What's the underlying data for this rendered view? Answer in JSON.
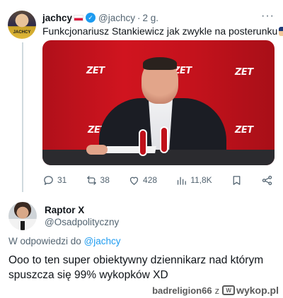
{
  "tweet1": {
    "name": "jachcy",
    "handle": "@jachcy",
    "separator": "·",
    "time": "2 g.",
    "text": "Funkcjonariusz Stankiewicz jak zwykle na posterunku",
    "avatar_text": "JACHCY",
    "more_label": "···",
    "media_logo": "ZET",
    "actions": {
      "replies": "31",
      "retweets": "38",
      "likes": "428",
      "views": "11,8K"
    }
  },
  "tweet2": {
    "name": "Raptor X",
    "handle": "@Osadpolityczny",
    "reply_prefix": "W odpowiedzi do",
    "reply_handle": "@jachcy",
    "text": "Ooo to ten super obiektywny dziennikarz nad którym spuszcza się 99% wykopków XD"
  },
  "footer": {
    "user": "badreligion66",
    "z": "z",
    "site": "wykop.pl",
    "site_mark": "W"
  },
  "colors": {
    "accent": "#1d9bf0",
    "muted": "#536471",
    "media_red": "#c4121c"
  },
  "icons": [
    "verified-icon",
    "poland-flag-icon",
    "police-emoji-icon",
    "reply-icon",
    "retweet-icon",
    "like-icon",
    "views-icon",
    "bookmark-icon",
    "share-icon",
    "wykop-logo-icon"
  ]
}
